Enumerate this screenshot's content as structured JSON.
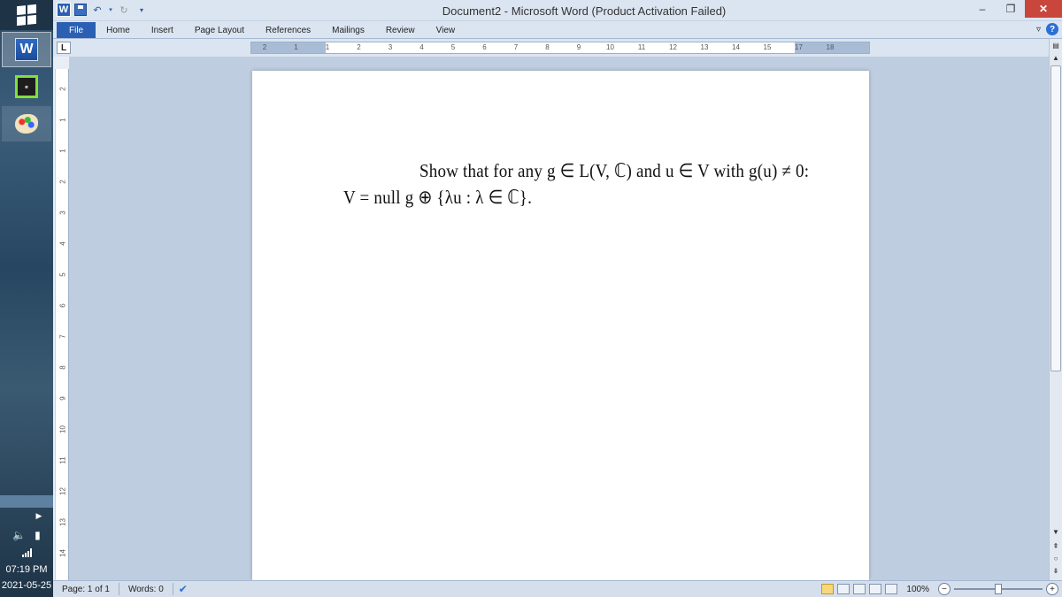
{
  "window": {
    "title": "Document2  -  Microsoft Word (Product Activation Failed)",
    "minimize": "–",
    "restore": "❐",
    "close": "✕"
  },
  "ribbon": {
    "tabs": [
      "File",
      "Home",
      "Insert",
      "Page Layout",
      "References",
      "Mailings",
      "Review",
      "View"
    ],
    "help_label": "?"
  },
  "taskbar": {
    "clock_time": "07:19 PM",
    "clock_date": "2021-05-25",
    "word_label": "W"
  },
  "ruler": {
    "tab_selector": "L",
    "h_numbers": [
      "2",
      "1",
      "1",
      "2",
      "3",
      "4",
      "5",
      "6",
      "7",
      "8",
      "9",
      "10",
      "11",
      "12",
      "13",
      "14",
      "15",
      "17",
      "18"
    ],
    "v_numbers": [
      "2",
      "1",
      "1",
      "2",
      "3",
      "4",
      "5",
      "6",
      "7",
      "8",
      "9",
      "10",
      "11",
      "12",
      "13",
      "14"
    ]
  },
  "document": {
    "line1": "Show that for any g ∈ L(V, ℂ) and u ∈ V  with g(u) ≠ 0:",
    "line2": "V = null g ⊕ {λu : λ ∈ ℂ}."
  },
  "status": {
    "page": "Page: 1 of 1",
    "words": "Words: 0",
    "zoom": "100%",
    "zoom_value": 100
  },
  "colors": {
    "file_tab": "#2b5fb3",
    "close_button": "#c9463d",
    "canvas": "#bfcde0"
  }
}
